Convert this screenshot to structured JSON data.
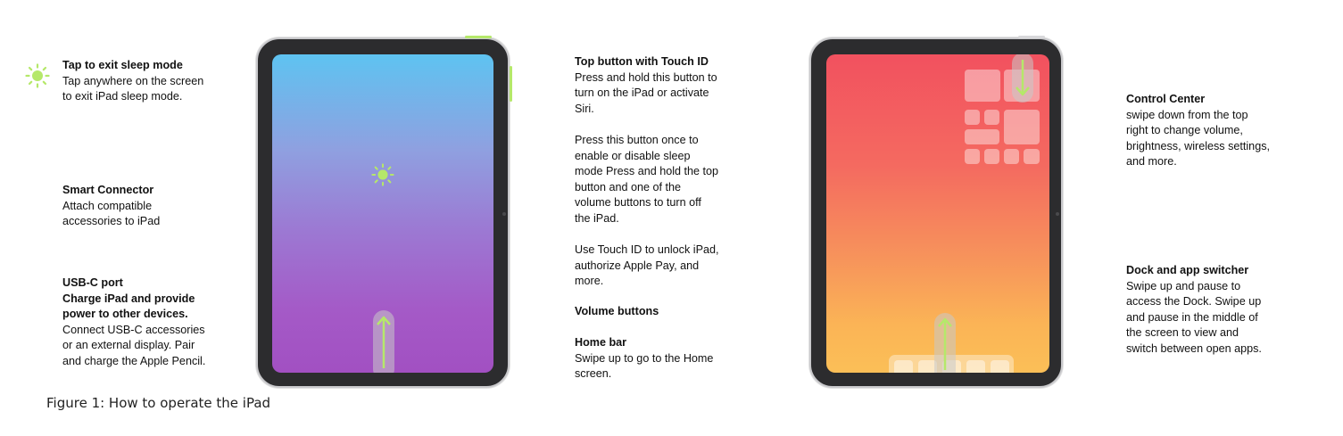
{
  "colors": {
    "accent": "#b5e86a"
  },
  "icons": {
    "sleep": "sun-icon",
    "gesture": "arrow-up-icon",
    "control_gesture": "arrow-down-icon"
  },
  "tap_to_exit": {
    "title": "Tap to exit sleep mode",
    "lines": [
      "Tap anywhere on the screen",
      "to exit iPad sleep mode."
    ]
  },
  "smart_connector": {
    "title": "Smart Connector",
    "lines": [
      "Attach compatible",
      "accessories to iPad"
    ]
  },
  "usb_c": {
    "title_lines": [
      "USB-C port",
      "Charge iPad and provide",
      "power to other devices."
    ],
    "lines": [
      "Connect USB-C accessories",
      "or an external display. Pair",
      "and charge the Apple Pencil."
    ]
  },
  "top_button": {
    "title": "Top button with Touch ID",
    "para1": [
      "Press and hold this button to",
      "turn on the iPad or activate",
      "Siri."
    ],
    "para2": [
      "Press this button once to",
      "enable or disable sleep",
      "mode Press and hold the top",
      "button and one of the",
      "volume buttons to turn off",
      "the iPad."
    ],
    "para3": [
      "Use Touch ID to unlock iPad,",
      "authorize Apple Pay, and",
      "more."
    ]
  },
  "volume_buttons": {
    "title": "Volume buttons"
  },
  "home_bar": {
    "title": "Home bar",
    "lines": [
      "Swipe up to go to the Home",
      "screen."
    ]
  },
  "control_center": {
    "title": "Control Center",
    "lines": [
      "swipe down from the top",
      "right to change volume,",
      "brightness, wireless settings,",
      "and more."
    ]
  },
  "dock": {
    "title": "Dock and app switcher",
    "lines": [
      "Swipe up and pause to",
      "access the Dock. Swipe up",
      "and pause in the middle of",
      "the screen to view and",
      "switch between open apps."
    ]
  },
  "caption": "Figure 1: How to operate the iPad"
}
